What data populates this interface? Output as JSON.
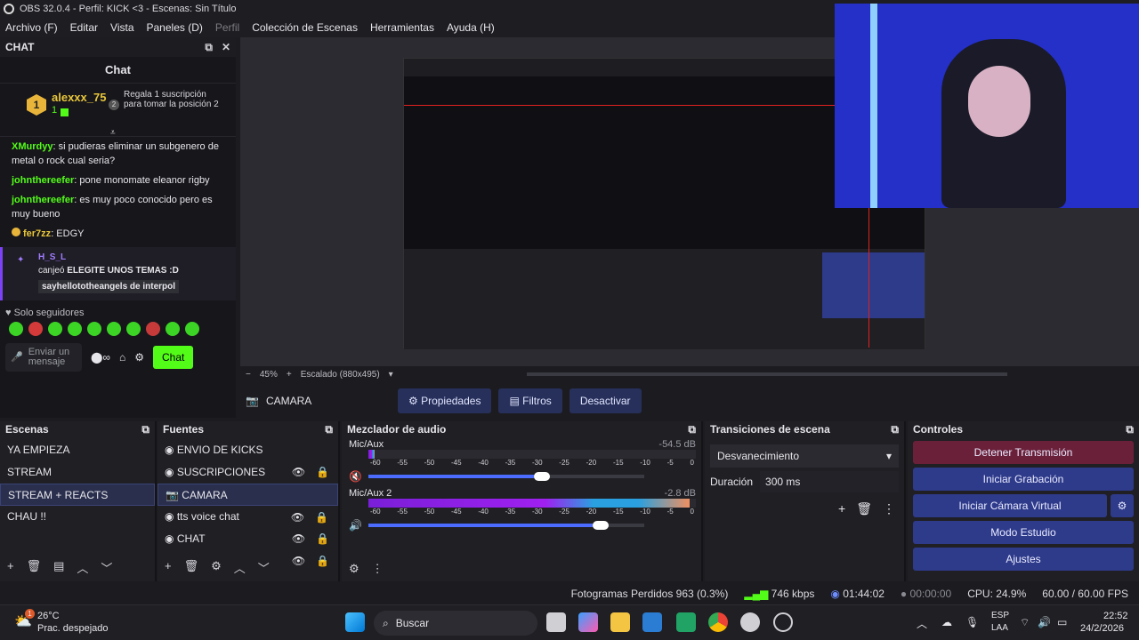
{
  "title_bar": {
    "text": "OBS 32.0.4 - Perfil: KICK <3 - Escenas: Sin Título"
  },
  "menu": [
    "Archivo (F)",
    "Editar",
    "Vista",
    "Paneles (D)",
    "Perfil",
    "Colección de Escenas",
    "Herramientas",
    "Ayuda (H)"
  ],
  "chat_dock": {
    "title": "CHAT",
    "panel_title": "Chat",
    "top_gifter": {
      "rank": "1",
      "name": "alexxx_75",
      "count": "1",
      "rank2": "2",
      "promo": "Regala 1 suscripción para tomar la posición 2"
    },
    "messages": [
      {
        "user": "XMurdyy",
        "text": ": si pudieras eliminar un subgenero de metal o rock cual seria?"
      },
      {
        "user": "johnthereefer",
        "text": ": pone monomate eleanor rigby"
      },
      {
        "user": "johnthereefer",
        "text": ": es muy poco conocido pero es muy bueno"
      },
      {
        "user": "fer7zz",
        "text": ": EDGY"
      }
    ],
    "redeem": {
      "user": "H_S_L",
      "text": "canjeó ",
      "reward": "ELEGITE UNOS TEMAS :D",
      "detail": "sayhellototheangels de interpol"
    },
    "followers_only": "Solo seguidores",
    "input_placeholder": "Enviar un mensaje",
    "send_label": "Chat"
  },
  "preview": {
    "zoom": "45%",
    "scaling": "Escalado (880x495)"
  },
  "source_toolbar": {
    "source_name": "CAMARA",
    "properties": "Propiedades",
    "filters": "Filtros",
    "deactivate": "Desactivar"
  },
  "scenes": {
    "title": "Escenas",
    "items": [
      "YA EMPIEZA",
      "STREAM",
      "STREAM + REACTS",
      "CHAU !!"
    ],
    "selected": 2
  },
  "sources": {
    "title": "Fuentes",
    "items": [
      "ENVIO DE KICKS",
      "SUSCRIPCIONES",
      "CAMARA",
      "tts voice chat",
      "CHAT"
    ],
    "selected": 2
  },
  "mixer": {
    "title": "Mezclador de audio",
    "tracks": [
      {
        "name": "Mic/Aux",
        "db": "-54.5 dB",
        "level": 0.02,
        "volume": 0.62
      },
      {
        "name": "Mic/Aux 2",
        "db": "-2.8 dB",
        "level": 0.98,
        "volume": 0.84
      }
    ],
    "ticks": [
      "-60",
      "-55",
      "-50",
      "-45",
      "-40",
      "-35",
      "-30",
      "-25",
      "-20",
      "-15",
      "-10",
      "-5",
      "0"
    ]
  },
  "transitions": {
    "title": "Transiciones de escena",
    "transition": "Desvanecimiento",
    "duration_label": "Duración",
    "duration": "300 ms"
  },
  "controls": {
    "title": "Controles",
    "buttons": [
      "Detener Transmisión",
      "Iniciar Grabación",
      "Iniciar Cámara Virtual",
      "Modo Estudio",
      "Ajustes"
    ]
  },
  "status": {
    "dropped": "Fotogramas Perdidos 963 (0.3%)",
    "kbps": "746 kbps",
    "live": "01:44:02",
    "rec": "00:00:00",
    "cpu": "CPU: 24.9%",
    "fps": "60.00 / 60.00 FPS"
  },
  "taskbar": {
    "weather_temp": "26°C",
    "weather_desc": "Prac. despejado",
    "weather_badge": "1",
    "search": "Buscar",
    "lang1": "ESP",
    "lang2": "LAA",
    "time": "22:52",
    "date": "24/2/2026"
  },
  "colors": {
    "kick_green": "#53fc18",
    "accent_blue": "#2e3a8a",
    "stop_red": "#6b2039",
    "purple": "#7b42f6"
  }
}
